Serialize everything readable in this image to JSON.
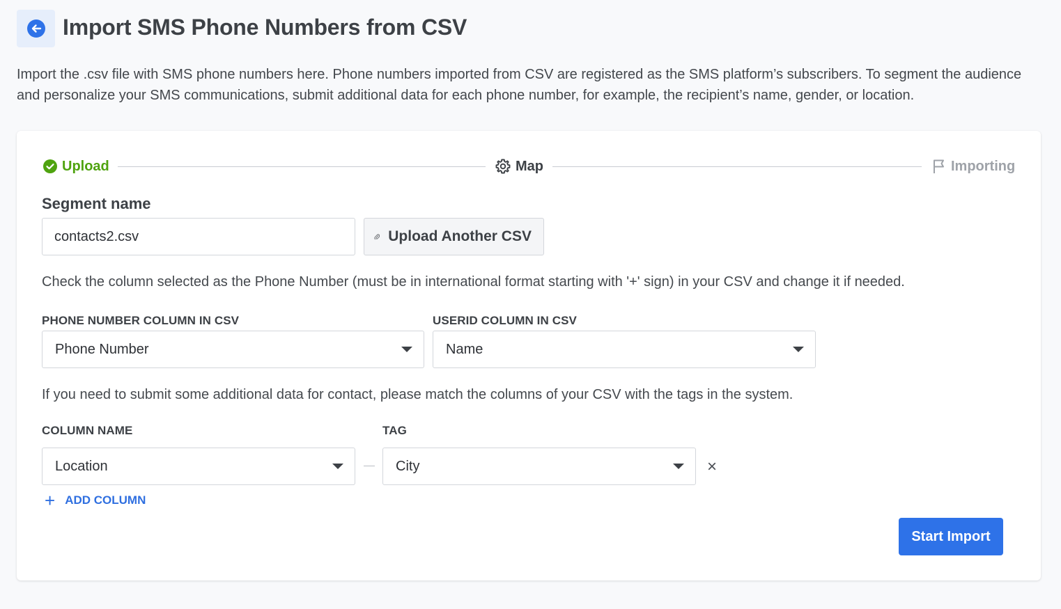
{
  "header": {
    "title": "Import SMS Phone Numbers from CSV",
    "description": "Import the .csv file with SMS phone numbers here. Phone numbers imported from CSV are registered as the SMS platform’s subscribers. To segment the audience and personalize your SMS communications, submit additional data for each phone number, for example, the recipient’s name, gender, or location."
  },
  "steps": [
    {
      "label": "Upload",
      "state": "completed",
      "icon": "check-circle-icon",
      "color": "#4fa30f"
    },
    {
      "label": "Map",
      "state": "active",
      "icon": "gear-icon",
      "color": "#3d4146"
    },
    {
      "label": "Importing",
      "state": "pending",
      "icon": "flag-icon",
      "color": "#9ea2a8"
    }
  ],
  "segment": {
    "label": "Segment name",
    "value": "contacts2.csv",
    "upload_button": "Upload Another CSV"
  },
  "phone_hint": "Check the column selected as the Phone Number (must be in international format starting with '+' sign) in your CSV and change it if needed.",
  "phone_column": {
    "label": "PHONE NUMBER COLUMN IN CSV",
    "value": "Phone Number"
  },
  "userid_column": {
    "label": "USERID COLUMN IN CSV",
    "value": "Name"
  },
  "additional_hint": "If you need to submit some additional data for contact, please match the columns of your CSV with the tags in the system.",
  "mapping": {
    "column_header": "COLUMN NAME",
    "tag_header": "TAG",
    "rows": [
      {
        "column": "Location",
        "tag": "City"
      }
    ],
    "remove_symbol": "×",
    "add_label": "ADD COLUMN",
    "add_symbol": "+"
  },
  "actions": {
    "start_import": "Start Import"
  },
  "colors": {
    "accent": "#2e72e8",
    "success": "#4fa30f",
    "background": "#f8f9fb"
  }
}
